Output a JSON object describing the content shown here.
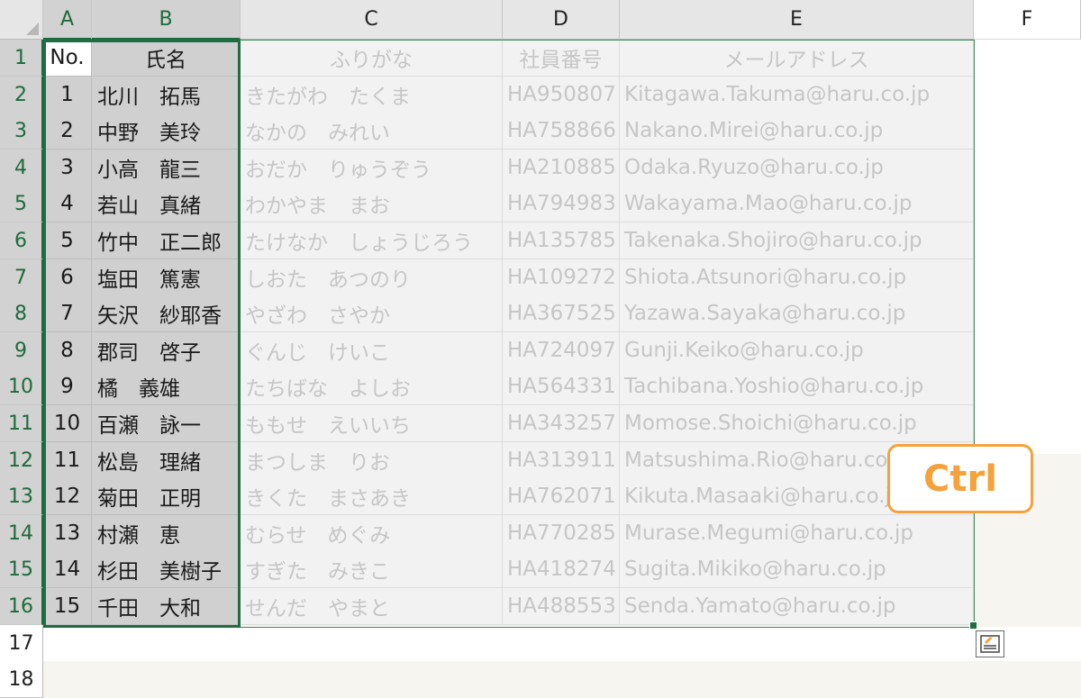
{
  "columns": [
    "A",
    "B",
    "C",
    "D",
    "E",
    "F"
  ],
  "rows": [
    "1",
    "2",
    "3",
    "4",
    "5",
    "6",
    "7",
    "8",
    "9",
    "10",
    "11",
    "12",
    "13",
    "14",
    "15",
    "16",
    "17",
    "18"
  ],
  "headers": {
    "no": "No.",
    "name": "氏名",
    "furigana": "ふりがな",
    "employee_id": "社員番号",
    "email": "メールアドレス"
  },
  "records": [
    {
      "no": "1",
      "name": "北川　拓馬",
      "furigana": "きたがわ　たくま",
      "id": "HA950807",
      "email": "Kitagawa.Takuma@haru.co.jp"
    },
    {
      "no": "2",
      "name": "中野　美玲",
      "furigana": "なかの　みれい",
      "id": "HA758866",
      "email": "Nakano.Mirei@haru.co.jp"
    },
    {
      "no": "3",
      "name": "小高　龍三",
      "furigana": "おだか　りゅうぞう",
      "id": "HA210885",
      "email": "Odaka.Ryuzo@haru.co.jp"
    },
    {
      "no": "4",
      "name": "若山　真緒",
      "furigana": "わかやま　まお",
      "id": "HA794983",
      "email": "Wakayama.Mao@haru.co.jp"
    },
    {
      "no": "5",
      "name": "竹中　正二郎",
      "furigana": "たけなか　しょうじろう",
      "id": "HA135785",
      "email": "Takenaka.Shojiro@haru.co.jp"
    },
    {
      "no": "6",
      "name": "塩田　篤憲",
      "furigana": "しおた　あつのり",
      "id": "HA109272",
      "email": "Shiota.Atsunori@haru.co.jp"
    },
    {
      "no": "7",
      "name": "矢沢　紗耶香",
      "furigana": "やざわ　さやか",
      "id": "HA367525",
      "email": "Yazawa.Sayaka@haru.co.jp"
    },
    {
      "no": "8",
      "name": "郡司　啓子",
      "furigana": "ぐんじ　けいこ",
      "id": "HA724097",
      "email": "Gunji.Keiko@haru.co.jp"
    },
    {
      "no": "9",
      "name": "橘　義雄",
      "furigana": "たちばな　よしお",
      "id": "HA564331",
      "email": "Tachibana.Yoshio@haru.co.jp"
    },
    {
      "no": "10",
      "name": "百瀬　詠一",
      "furigana": "ももせ　えいいち",
      "id": "HA343257",
      "email": "Momose.Shoichi@haru.co.jp"
    },
    {
      "no": "11",
      "name": "松島　理緒",
      "furigana": "まつしま　りお",
      "id": "HA313911",
      "email": "Matsushima.Rio@haru.co.jp"
    },
    {
      "no": "12",
      "name": "菊田　正明",
      "furigana": "きくた　まさあき",
      "id": "HA762071",
      "email": "Kikuta.Masaaki@haru.co.jp"
    },
    {
      "no": "13",
      "name": "村瀬　恵",
      "furigana": "むらせ　めぐみ",
      "id": "HA770285",
      "email": "Murase.Megumi@haru.co.jp"
    },
    {
      "no": "14",
      "name": "杉田　美樹子",
      "furigana": "すぎた　みきこ",
      "id": "HA418274",
      "email": "Sugita.Mikiko@haru.co.jp"
    },
    {
      "no": "15",
      "name": "千田　大和",
      "furigana": "せんだ　やまと",
      "id": "HA488553",
      "email": "Senda.Yamato@haru.co.jp"
    }
  ],
  "overlay": {
    "ctrl_label": "Ctrl"
  },
  "quick_analysis": {
    "icon": "quick-analysis-icon"
  },
  "colors": {
    "selection_border": "#1f6e43",
    "ctrl_accent": "#f5a23c",
    "selected_fill": "#d0d0d0",
    "dimmed_text": "#c6c6c6"
  }
}
